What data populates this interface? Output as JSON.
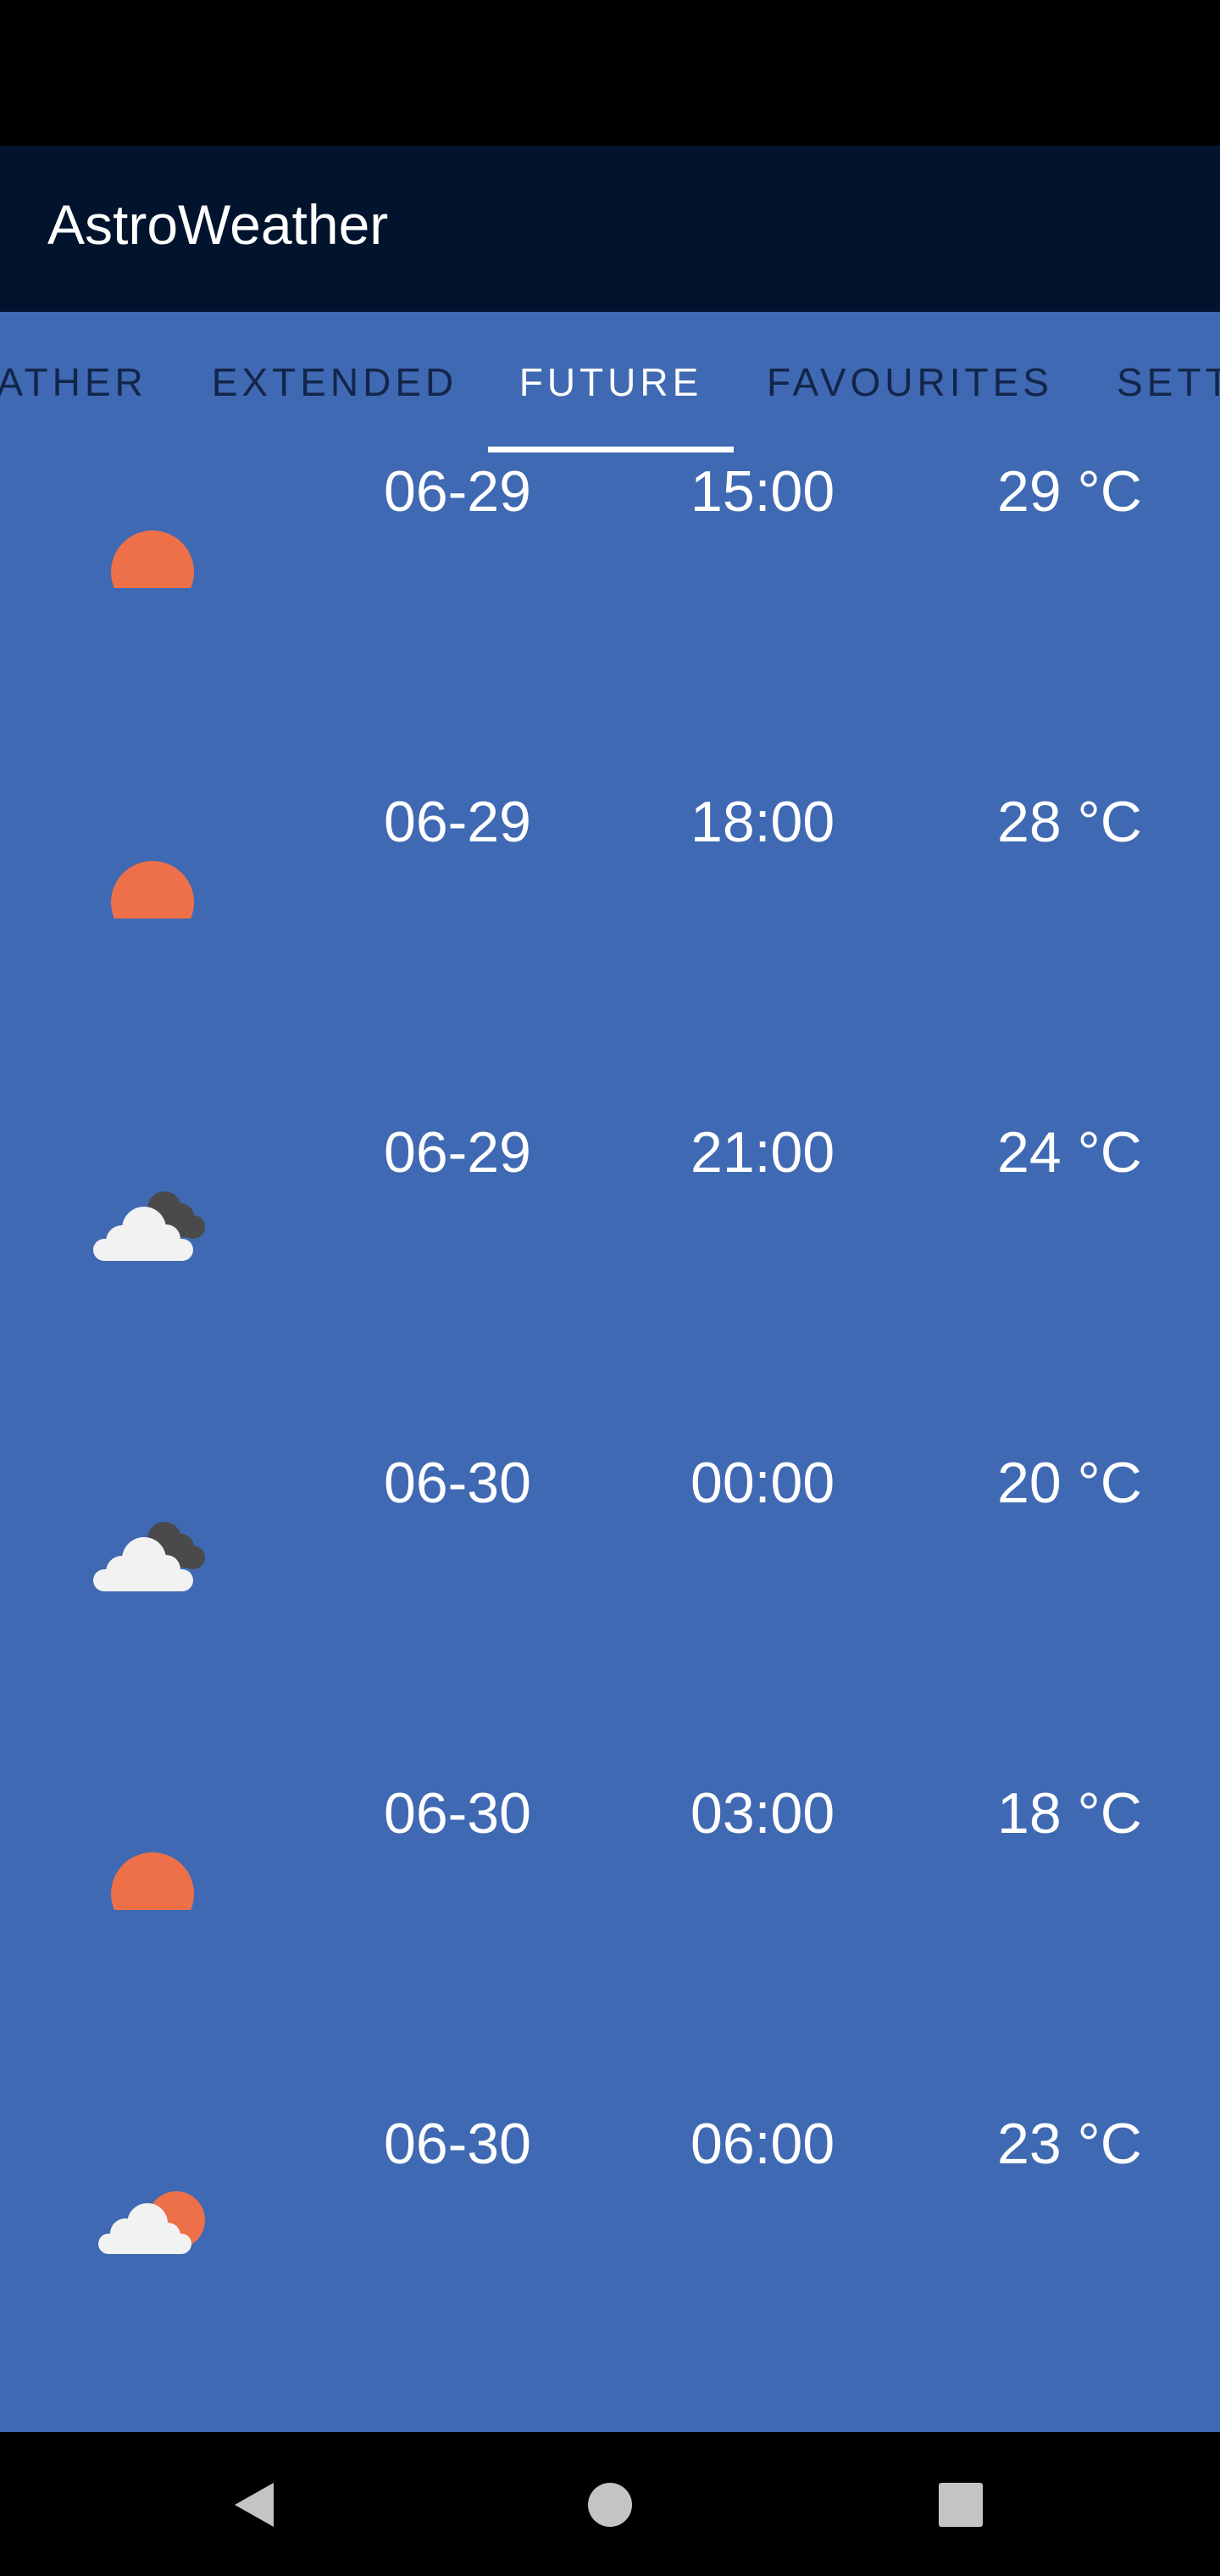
{
  "app": {
    "title": "AstroWeather"
  },
  "tabs": [
    {
      "label": "WEATHER",
      "visible_text": "ATHER",
      "selected": false
    },
    {
      "label": "EXTENDED",
      "visible_text": "EXTENDED",
      "selected": false
    },
    {
      "label": "FUTURE",
      "visible_text": "FUTURE",
      "selected": true
    },
    {
      "label": "FAVOURITES",
      "visible_text": "FAVOURITES",
      "selected": false
    },
    {
      "label": "SETTINGS",
      "visible_text": "SETT",
      "selected": false
    }
  ],
  "forecast": [
    {
      "date": "06-29",
      "time": "15:00",
      "temp": "29 °C",
      "icon": "sun-icon"
    },
    {
      "date": "06-29",
      "time": "18:00",
      "temp": "28 °C",
      "icon": "sun-icon"
    },
    {
      "date": "06-29",
      "time": "21:00",
      "temp": "24 °C",
      "icon": "dark-clouds-icon"
    },
    {
      "date": "06-30",
      "time": "00:00",
      "temp": "20 °C",
      "icon": "dark-clouds-icon"
    },
    {
      "date": "06-30",
      "time": "03:00",
      "temp": "18 °C",
      "icon": "sun-icon"
    },
    {
      "date": "06-30",
      "time": "06:00",
      "temp": "23 °C",
      "icon": "partly-cloudy-icon"
    }
  ],
  "nav": {
    "back": "back-icon",
    "home": "home-icon",
    "recents": "recents-icon"
  },
  "colors": {
    "app_bar": "#02132e",
    "primary_bg": "#3f69b2",
    "tab_inactive": "#13254a",
    "tab_active": "#ffffff",
    "sun": "#ee7049",
    "cloud_light": "#f2f2f2",
    "cloud_dark": "#4a4a4a"
  }
}
